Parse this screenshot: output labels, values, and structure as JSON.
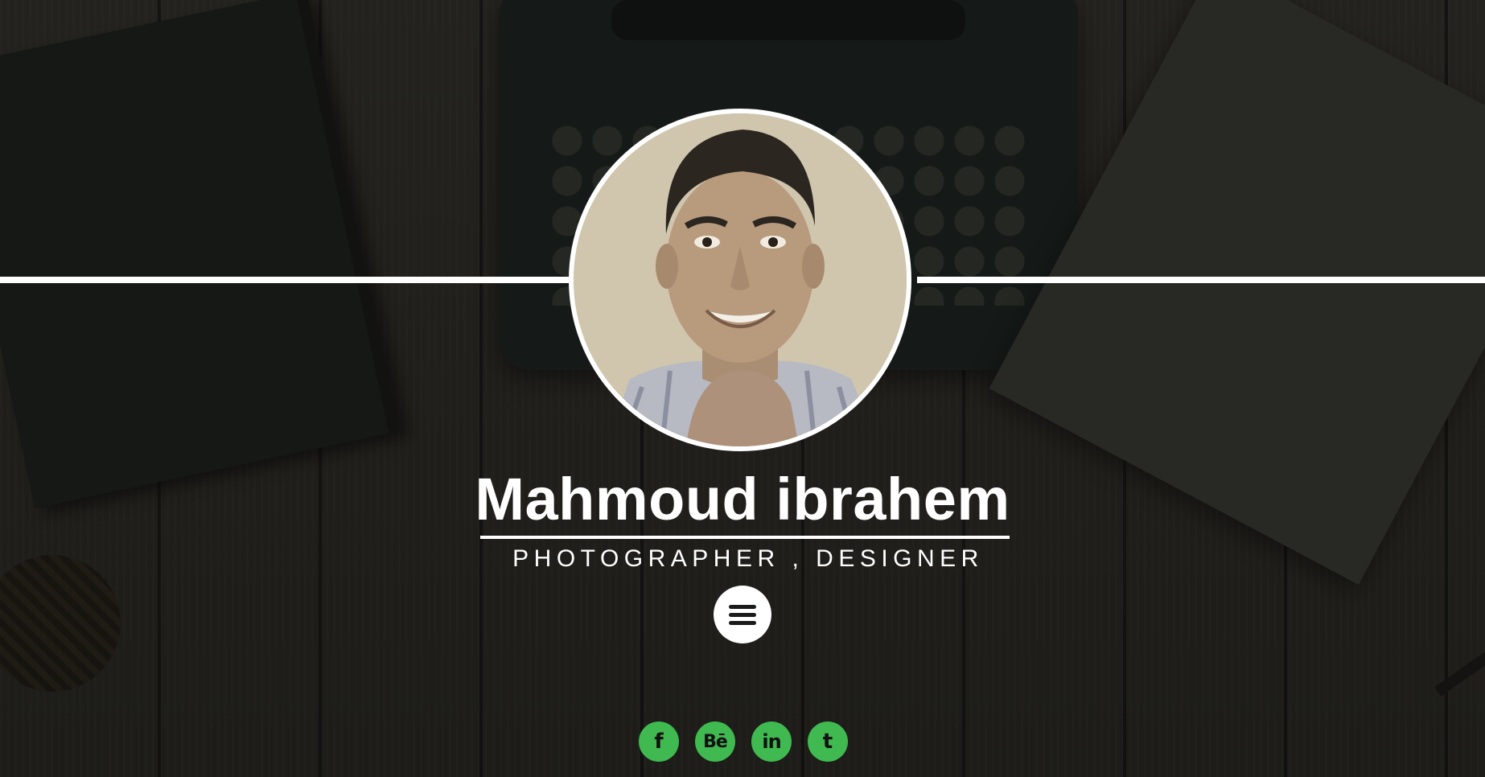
{
  "profile": {
    "name": "Mahmoud ibrahem",
    "tagline": "PHOTOGRAPHER , DESIGNER",
    "avatar_icon": "profile-photo"
  },
  "menu": {
    "icon": "hamburger-menu-icon"
  },
  "social": [
    {
      "network": "facebook",
      "glyph": "f"
    },
    {
      "network": "behance",
      "glyph": "Bē"
    },
    {
      "network": "linkedin",
      "glyph": "in"
    },
    {
      "network": "twitter",
      "glyph": "t"
    }
  ],
  "colors": {
    "social_accent": "#3fb950",
    "divider": "#ffffff",
    "text": "#ffffff"
  }
}
